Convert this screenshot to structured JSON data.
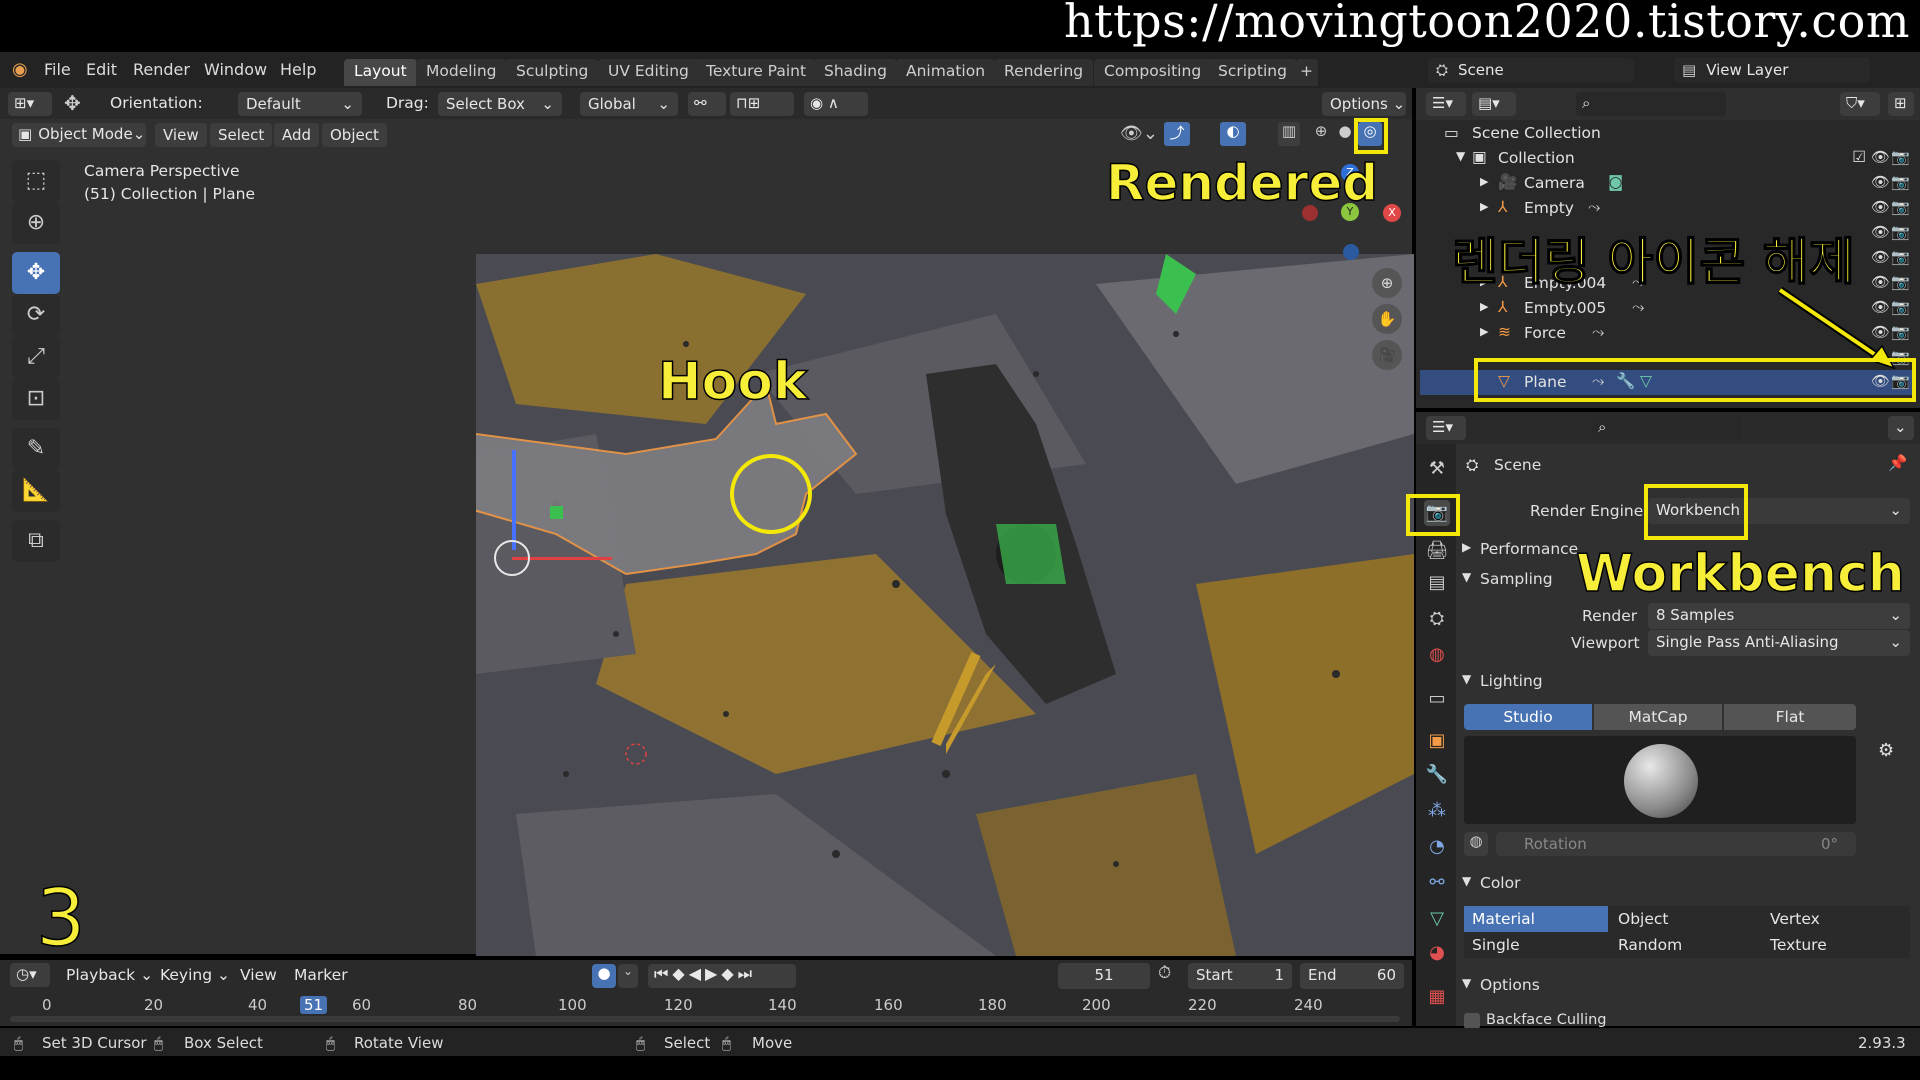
{
  "watermark": "https://movingtoon2020.tistory.com",
  "menu": [
    "File",
    "Edit",
    "Render",
    "Window",
    "Help"
  ],
  "workspaces": [
    "Layout",
    "Modeling",
    "Sculpting",
    "UV Editing",
    "Texture Paint",
    "Shading",
    "Animation",
    "Rendering",
    "Compositing",
    "Scripting"
  ],
  "workspace_add": "+",
  "scene_selector": "Scene",
  "view_layer": "View Layer",
  "tool_header": {
    "orientation_label": "Orientation:",
    "orientation_value": "Default",
    "drag_label": "Drag:",
    "drag_value": "Select Box",
    "transform_value": "Global",
    "options": "Options"
  },
  "viewport_header": {
    "mode": "Object Mode",
    "view": "View",
    "select": "Select",
    "add": "Add",
    "object": "Object"
  },
  "viewport_overlay": {
    "line1": "Camera Perspective",
    "line2": "(51) Collection | Plane"
  },
  "gizmo": {
    "z": "Z",
    "y": "Y",
    "x": "X"
  },
  "outliner": {
    "scene_collection": "Scene Collection",
    "collection": "Collection",
    "items": [
      {
        "name": "Camera"
      },
      {
        "name": "Empty"
      },
      {
        "name": "Empty.004"
      },
      {
        "name": "Empty.005"
      },
      {
        "name": "Force"
      },
      {
        "name": "Plane"
      }
    ]
  },
  "properties": {
    "context": "Scene",
    "render_engine_label": "Render Engine",
    "render_engine_value": "Workbench",
    "performance": "Performance",
    "sampling": "Sampling",
    "render_label": "Render",
    "render_value": "8 Samples",
    "viewport_label": "Viewport",
    "viewport_value": "Single Pass Anti-Aliasing",
    "lighting": "Lighting",
    "lighting_modes": [
      "Studio",
      "MatCap",
      "Flat"
    ],
    "rotation_label": "Rotation",
    "rotation_value": "0°",
    "color": "Color",
    "color_modes": [
      "Material",
      "Object",
      "Vertex",
      "Single",
      "Random",
      "Texture"
    ],
    "options": "Options",
    "backface_culling": "Backface Culling"
  },
  "timeline": {
    "playback": "Playback",
    "keying": "Keying",
    "view": "View",
    "marker": "Marker",
    "current_frame": "51",
    "start_label": "Start",
    "start_value": "1",
    "end_label": "End",
    "end_value": "60",
    "ticks": [
      "0",
      "20",
      "40",
      "51",
      "60",
      "80",
      "100",
      "120",
      "140",
      "160",
      "180",
      "200",
      "220",
      "240"
    ]
  },
  "statusbar": {
    "set_cursor": "Set 3D Cursor",
    "box_select": "Box Select",
    "rotate_view": "Rotate View",
    "select": "Select",
    "move": "Move",
    "version": "2.93.3"
  },
  "annotations": {
    "rendered": "Rendered",
    "hook": "Hook",
    "unset_render_icon": "렌더링 아이콘 해제",
    "workbench": "Workbench",
    "step": "3"
  },
  "colors": {
    "accent_blue": "#4772b3",
    "annotation_yellow": "#f4e80a",
    "object_orange": "#f29a45",
    "ui_bg": "#303030"
  }
}
